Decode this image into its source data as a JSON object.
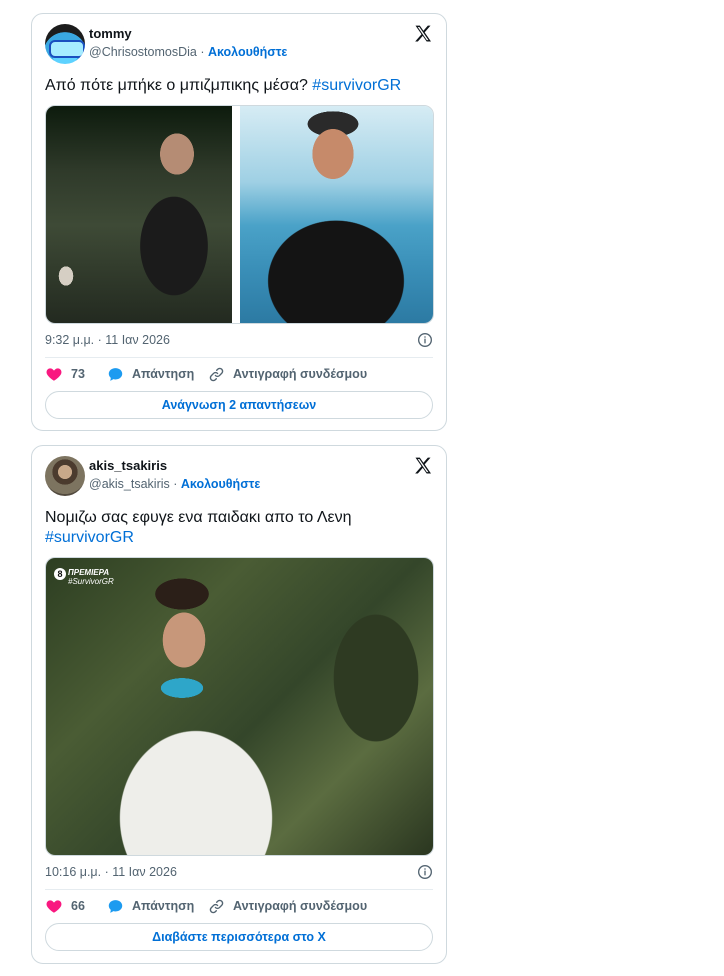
{
  "tweets": [
    {
      "display_name": "tommy",
      "handle": "@ChrisostomosDia",
      "separator": " · ",
      "follow_label": "Ακολουθήστε",
      "text": "Από πότε μπήκε ο μπιζμπικης μέσα? ",
      "hashtag": "#survivorGR",
      "timestamp": "9:32 μ.μ. · 11 Ιαν 2026",
      "likes": "73",
      "reply_label": "Απάντηση",
      "copy_link_label": "Αντιγραφή συνδέσμου",
      "cta_label": "Ανάγνωση 2 απαντήσεων"
    },
    {
      "display_name": "akis_tsakiris",
      "handle": "@akis_tsakiris",
      "separator": " · ",
      "follow_label": "Ακολουθήστε",
      "text": "Νομιζω σας εφυγε ενα παιδακι απο το Λενη",
      "hashtag": "#survivorGR",
      "timestamp": "10:16 μ.μ. · 11 Ιαν 2026",
      "likes": "66",
      "reply_label": "Απάντηση",
      "copy_link_label": "Αντιγραφή συνδέσμου",
      "cta_label": "Διαβάστε περισσότερα στο X",
      "media_overlay": {
        "channel": "8",
        "tag_line1": "ΠΡΕΜΙΕΡΑ",
        "tag_line2": "#SurvivorGR"
      }
    }
  ],
  "colors": {
    "accent": "#006fd6",
    "like": "#f91880",
    "reply": "#1d9bf0",
    "muted": "#536471",
    "border": "#cfd9de"
  },
  "icons": [
    "x-logo-icon",
    "info-icon",
    "heart-icon",
    "reply-bubble-icon",
    "link-icon"
  ]
}
